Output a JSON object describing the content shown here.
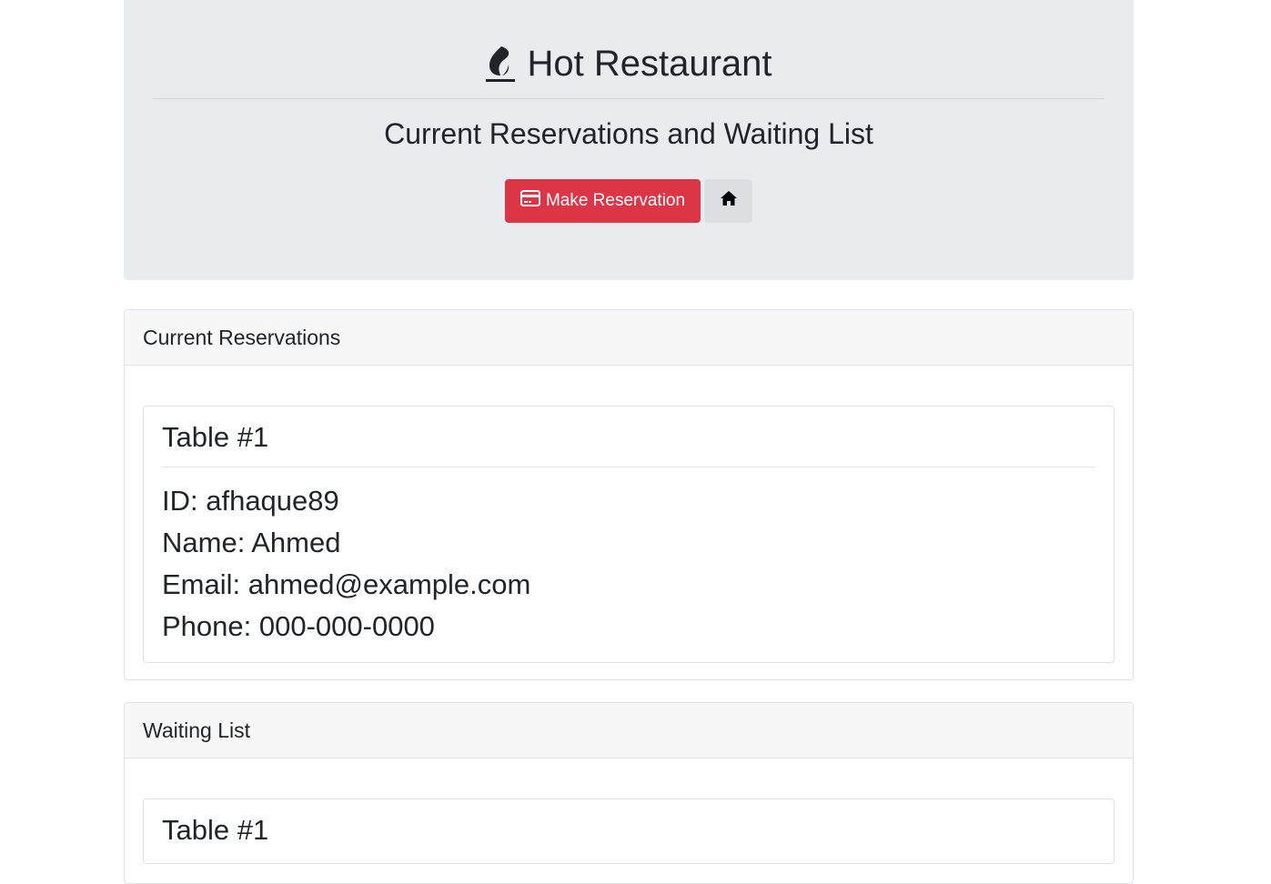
{
  "header": {
    "title": "Hot Restaurant",
    "title_icon": "fire-icon",
    "subtitle": "Current Reservations and Waiting List",
    "make_reservation_label": "Make Reservation",
    "make_reservation_icon": "credit-card-icon",
    "home_icon": "home-icon"
  },
  "reservations": {
    "heading": "Current Reservations",
    "items": [
      {
        "title": "Table #1",
        "id_line": "ID: afhaque89",
        "name_line": "Name: Ahmed",
        "email_line": "Email: ahmed@example.com",
        "phone_line": "Phone: 000-000-0000"
      }
    ]
  },
  "waiting_list": {
    "heading": "Waiting List",
    "items": [
      {
        "title": "Table #1"
      }
    ]
  },
  "colors": {
    "jumbotron_bg": "#e9ecef",
    "danger": "#dc3545",
    "card_header_bg": "#f7f7f7",
    "text": "#212529"
  }
}
